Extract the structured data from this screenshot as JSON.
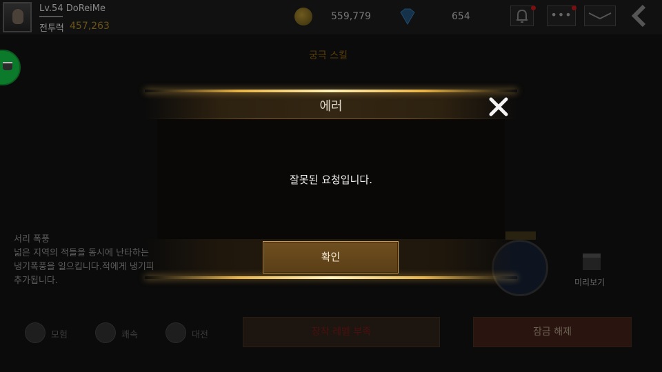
{
  "player": {
    "level_name": "Lv.54 DoReiMe",
    "power_label": "전투력",
    "power_value": "457,263"
  },
  "currency": {
    "gold": "559,779",
    "gems": "654"
  },
  "topbar_icons": [
    "bell-icon",
    "more-icon",
    "fold-icon",
    "back-arrow-icon"
  ],
  "skill_section": {
    "title": "궁극 스킬",
    "skill_name": "서리 폭풍",
    "description": [
      "넓은 지역의 적들을 동시에 난타하는",
      "냉기폭풍을 일으킵니다.적에게 냉기피",
      "추가됩니다."
    ],
    "tabs": [
      "모험",
      "쾌속",
      "대전"
    ],
    "preview_label": "미리보기",
    "level_button": "장착 레벨 부족",
    "unlock_button": "잠금 해제"
  },
  "modal": {
    "title": "에러",
    "message": "잘못된 요청입니다.",
    "confirm_label": "확인"
  },
  "colors": {
    "accent_gold": "#e6b24a",
    "button_brown": "#6f4f20",
    "button_border": "#c99a4e",
    "notification_red": "#7a1010"
  }
}
